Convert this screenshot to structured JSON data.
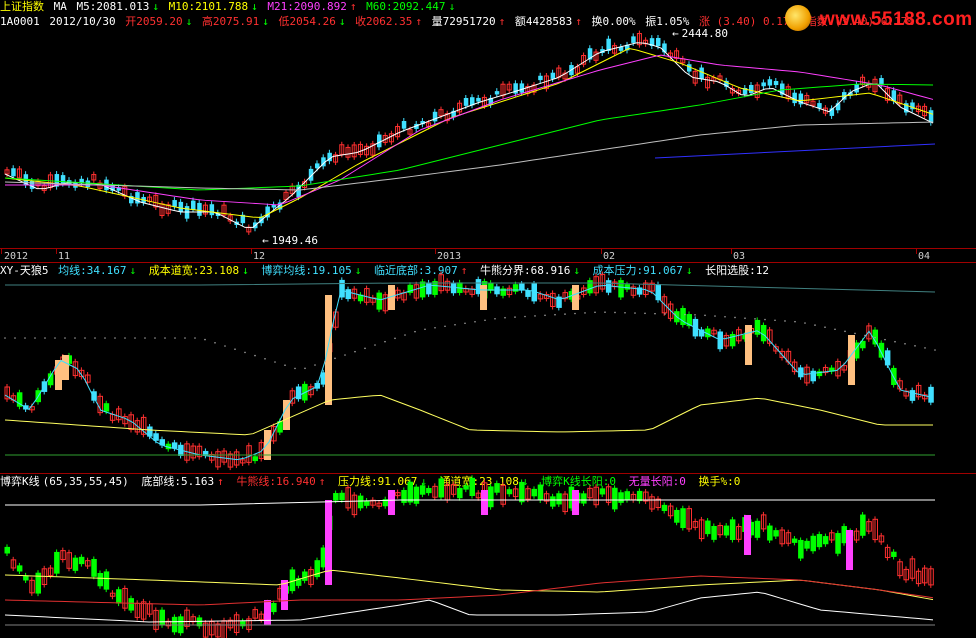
{
  "header": {
    "title": "上证指数",
    "ma_label": "MA",
    "m5": "M5:2081.013",
    "m10": "M10:2101.788",
    "m21": "M21:2090.892",
    "m60": "M60:2092.447"
  },
  "quote": {
    "code": "1A0001",
    "date": "2012/10/30",
    "open": "开2059.20",
    "high": "高2075.91",
    "low": "低2054.26",
    "close": "收2062.35",
    "volume": "量72951720",
    "amount": "额4428583",
    "turnover": "换0.00%",
    "amplitude": "振1.05%",
    "change": "涨 (3.40) 0.17%",
    "index": "指数 (3.40) 0.17%"
  },
  "watermark": {
    "site": "www.55188.com"
  },
  "price_labels": {
    "high": "2444.80",
    "low": "1949.46"
  },
  "time_axis": {
    "labels": [
      "2012",
      "11",
      "12",
      "2013",
      "02",
      "03",
      "04"
    ]
  },
  "panel2": {
    "name": "XY-天狼5",
    "items": [
      {
        "text": "均线:34.167",
        "color": "#40e0ff",
        "arrow": "↓"
      },
      {
        "text": "成本道宽:23.108",
        "color": "#ffff00",
        "arrow": "↓"
      },
      {
        "text": "博弈均线:19.105",
        "color": "#40e0ff",
        "arrow": "↓"
      },
      {
        "text": "临近底部:3.907",
        "color": "#40e0ff",
        "arrow": "↑"
      },
      {
        "text": "牛熊分界:68.916",
        "color": "#ffffff",
        "arrow": "↓"
      },
      {
        "text": "成本压力:91.067",
        "color": "#40e0ff",
        "arrow": "↓"
      },
      {
        "text": "长阳选股:12",
        "color": "#ffffff",
        "arrow": ""
      }
    ]
  },
  "panel3": {
    "name": "博弈K线",
    "params": "(65,35,55,45)",
    "items": [
      {
        "text": "底部线:5.163",
        "color": "#ffffff",
        "arrow": "↑"
      },
      {
        "text": "牛熊线:16.940",
        "color": "#ff3030",
        "arrow": "↑"
      },
      {
        "text": "压力线:91.067",
        "color": "#ffff00",
        "arrow": "↓"
      },
      {
        "text": "通道宽:23.108",
        "color": "#ffff00",
        "arrow": "↓"
      },
      {
        "text": "博弈K线长阳:0",
        "color": "#00ff00",
        "arrow": ""
      },
      {
        "text": "无量长阳:0",
        "color": "#ff40ff",
        "arrow": ""
      },
      {
        "text": "换手%:0",
        "color": "#ffff00",
        "arrow": ""
      }
    ]
  },
  "colors": {
    "up": "#ff3030",
    "down": "#40e0ff",
    "down_green": "#00ff00",
    "boyi_up": "#ff40ff",
    "ma5": "#ffffff",
    "ma10": "#ffff00",
    "ma21": "#ff40ff",
    "ma60": "#00ff00"
  },
  "chart_data": {
    "type": "candlestick",
    "series": [
      {
        "name": "M5",
        "values": []
      },
      {
        "name": "M10",
        "values": []
      },
      {
        "name": "M21",
        "values": []
      },
      {
        "name": "M60",
        "values": []
      }
    ],
    "annotations": [
      "2444.80",
      "1949.46"
    ]
  }
}
